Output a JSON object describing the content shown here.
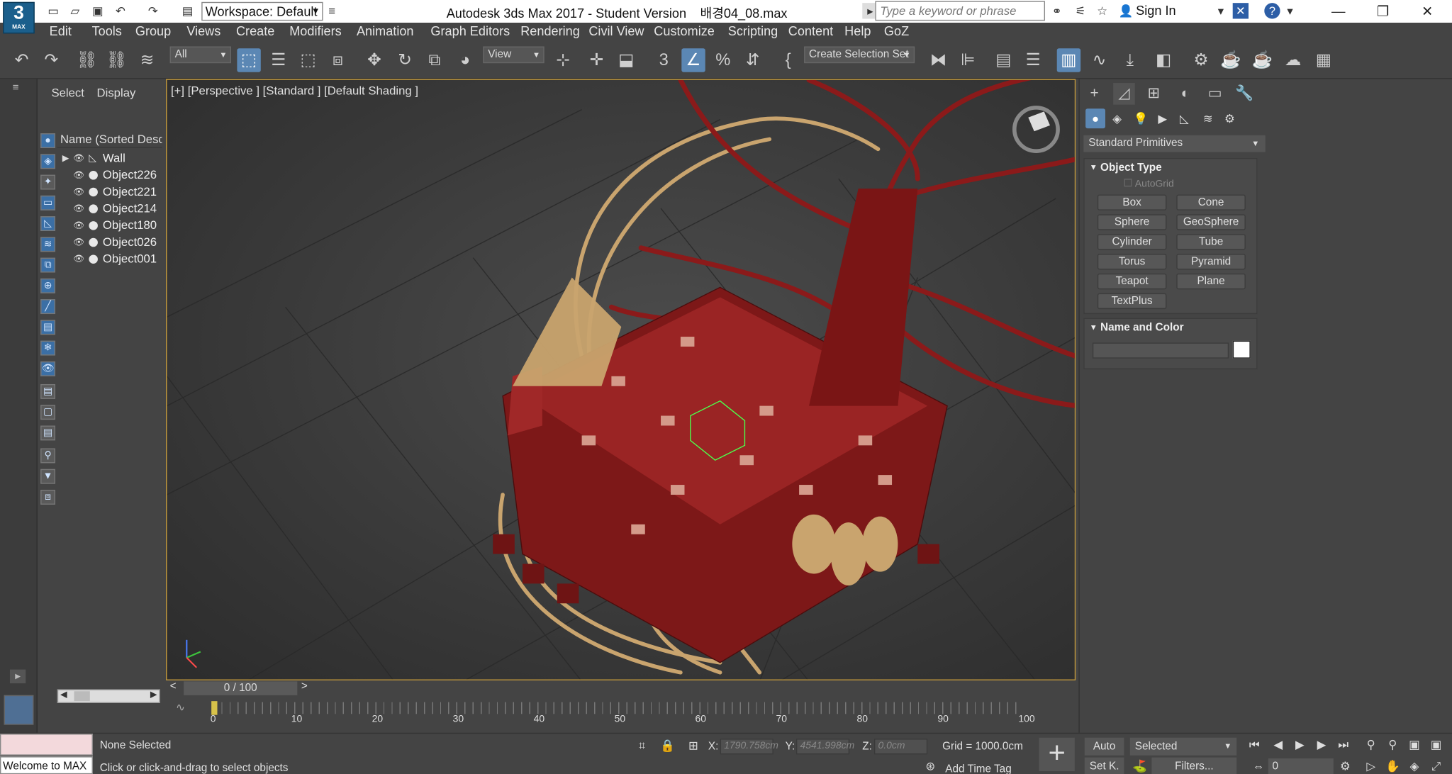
{
  "titlebar": {
    "workspace": "Workspace: Default",
    "app_title": "Autodesk 3ds Max 2017 - Student Version",
    "file_name": "배경04_08.max",
    "search_placeholder": "Type a keyword or phrase",
    "sign_in": "Sign In",
    "logo_number": "3",
    "logo_label": "MAX"
  },
  "menus": [
    "Edit",
    "Tools",
    "Group",
    "Views",
    "Create",
    "Modifiers",
    "Animation",
    "Graph Editors",
    "Rendering",
    "Civil View",
    "Customize",
    "Scripting",
    "Content",
    "Help",
    "GoZ"
  ],
  "toolbar": {
    "filter": "All",
    "ref_coord": "View",
    "selection_set": "Create Selection Set"
  },
  "explorer": {
    "tabs": [
      "Select",
      "Display"
    ],
    "column_header": "Name (Sorted Descending)",
    "items": [
      {
        "name": "Wall"
      },
      {
        "name": "Object226"
      },
      {
        "name": "Object221"
      },
      {
        "name": "Object214"
      },
      {
        "name": "Object180"
      },
      {
        "name": "Object026"
      },
      {
        "name": "Object001"
      }
    ]
  },
  "viewport": {
    "label": "[+] [Perspective ] [Standard ] [Default Shading ]"
  },
  "command_panel": {
    "category": "Standard Primitives",
    "object_type_title": "Object Type",
    "autogrid": "AutoGrid",
    "primitives": [
      "Box",
      "Cone",
      "Sphere",
      "GeoSphere",
      "Cylinder",
      "Tube",
      "Torus",
      "Pyramid",
      "Teapot",
      "Plane",
      "TextPlus"
    ],
    "name_color_title": "Name and Color",
    "swatch_color": "#ffffff"
  },
  "timeline": {
    "slider": "0 / 100",
    "ticks": [
      "0",
      "10",
      "20",
      "30",
      "40",
      "50",
      "60",
      "70",
      "80",
      "90",
      "100"
    ]
  },
  "status": {
    "maxscript": "Welcome to MAX",
    "selection": "None Selected",
    "prompt": "Click or click-and-drag to select objects",
    "x_label": "X:",
    "x_value": "1790.758cm",
    "y_label": "Y:",
    "y_value": "4541.998cm",
    "z_label": "Z:",
    "z_value": "0.0cm",
    "grid": "Grid = 1000.0cm",
    "add_time_tag": "Add Time Tag",
    "auto_key": "Auto",
    "set_key": "Set K.",
    "key_mode": "Selected",
    "filters": "Filters...",
    "frame": "0"
  },
  "colors": {
    "accent": "#5b87b4",
    "viewport_border": "#c49a3c",
    "model_red": "#8b1a1a",
    "model_tan": "#c9a46e"
  }
}
